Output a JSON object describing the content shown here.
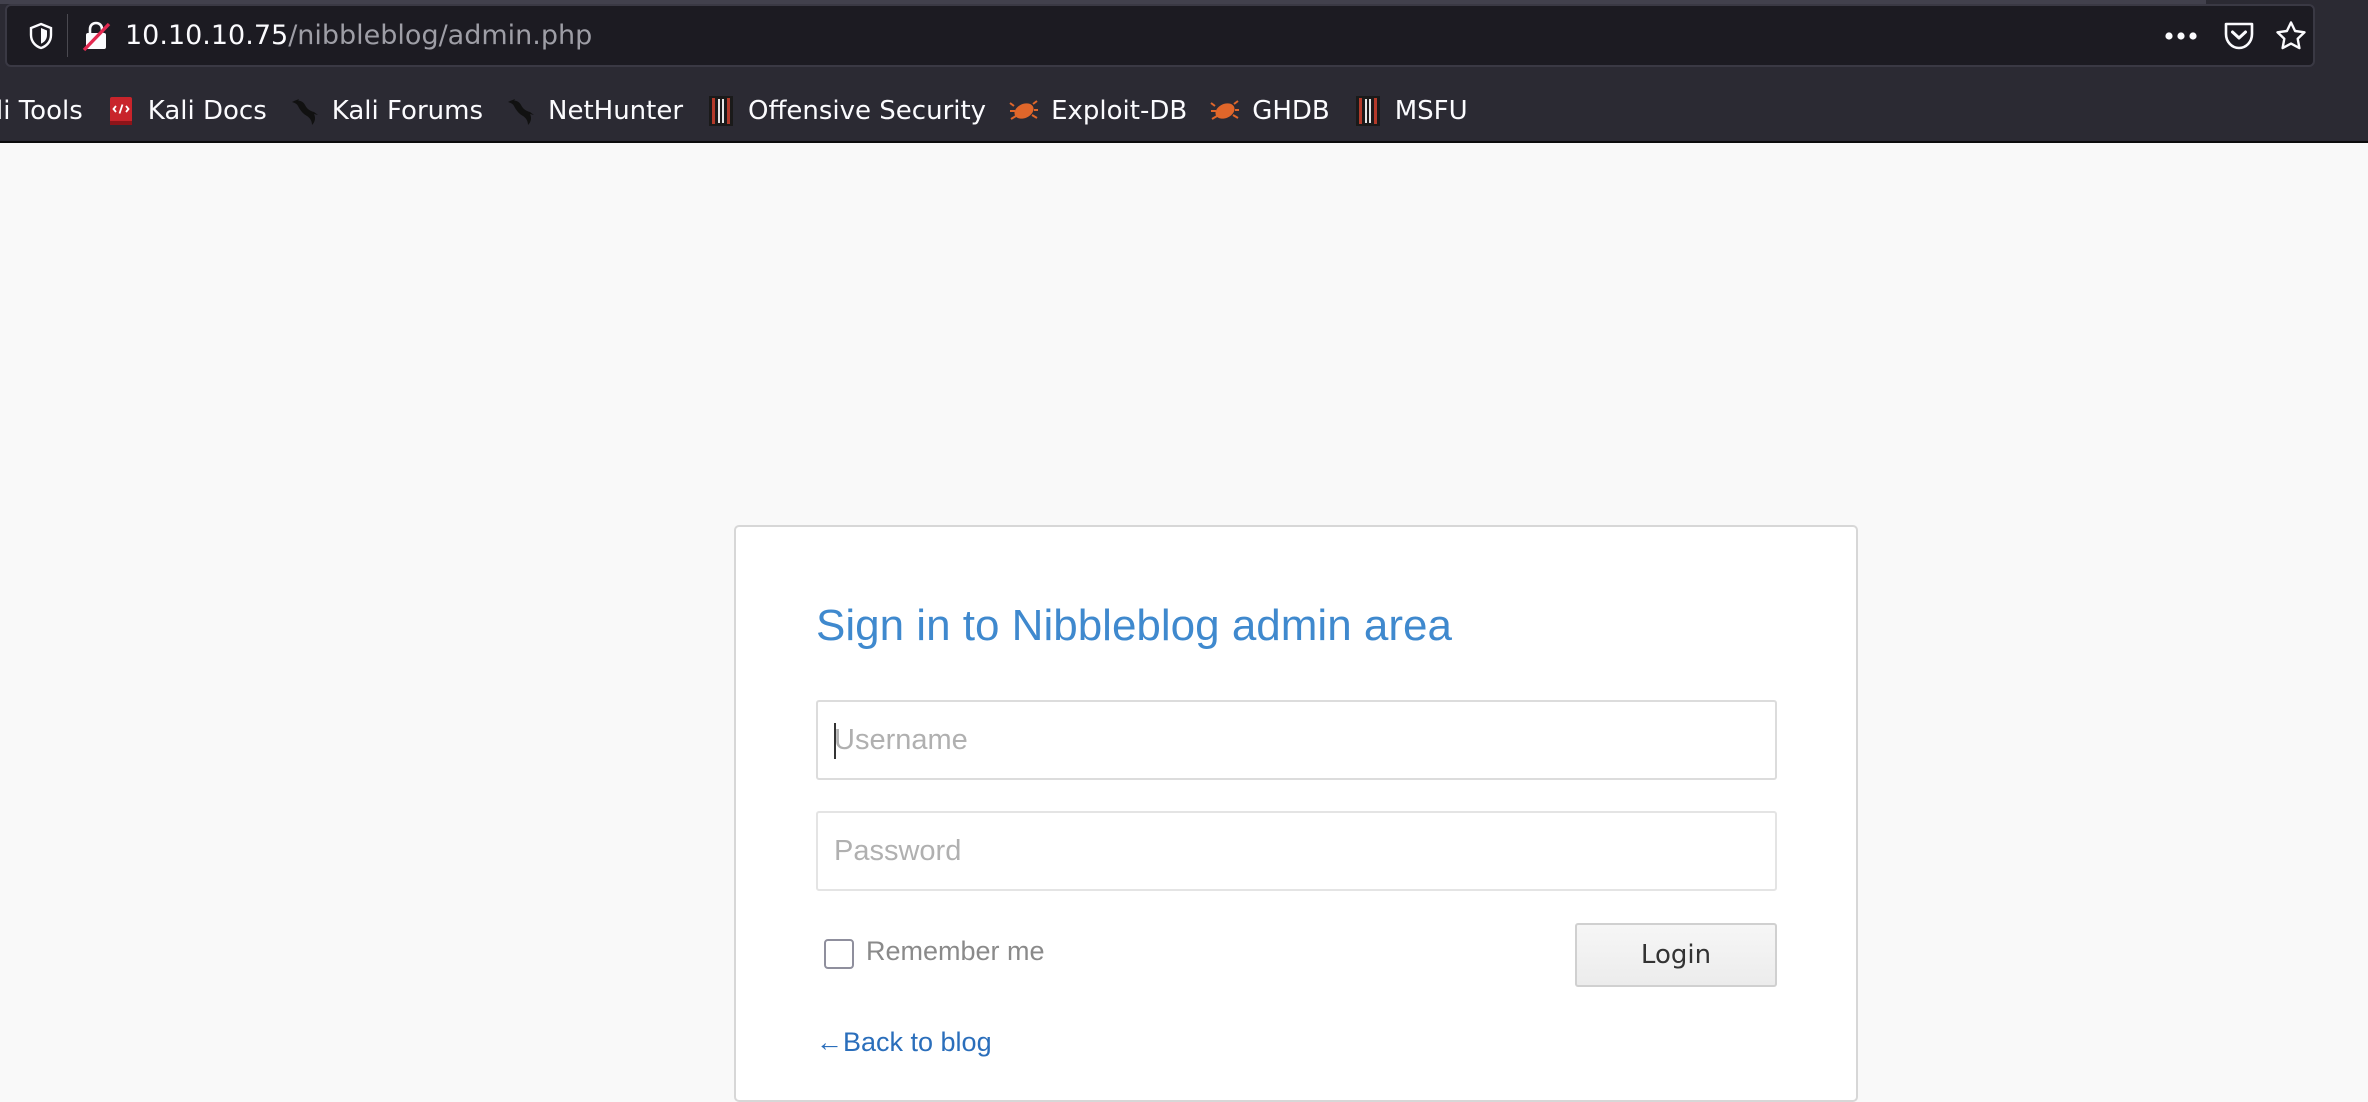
{
  "browser": {
    "url_host": "10.10.10.75",
    "url_path": "/nibbleblog/admin.php",
    "icons": {
      "tracking_protection": "shield-icon",
      "connection": "insecure-lock-icon",
      "page_actions": "more-horizontal-icon",
      "pocket": "pocket-icon",
      "bookmark_star": "star-icon"
    }
  },
  "bookmarks": [
    {
      "label": "li Tools",
      "icon": "none"
    },
    {
      "label": "Kali Docs",
      "icon": "kali-docs-icon"
    },
    {
      "label": "Kali Forums",
      "icon": "kali-dragon-icon"
    },
    {
      "label": "NetHunter",
      "icon": "kali-dragon-icon"
    },
    {
      "label": "Offensive Security",
      "icon": "offsec-icon"
    },
    {
      "label": "Exploit-DB",
      "icon": "exploitdb-bug-icon"
    },
    {
      "label": "GHDB",
      "icon": "exploitdb-bug-icon"
    },
    {
      "label": "MSFU",
      "icon": "offsec-icon"
    }
  ],
  "login": {
    "heading": "Sign in to Nibbleblog admin area",
    "username_placeholder": "Username",
    "password_placeholder": "Password",
    "remember_label": "Remember me",
    "login_label": "Login",
    "back_link": "←Back to blog"
  },
  "colors": {
    "heading_blue": "#3f89ce",
    "link_blue": "#2a6ebb",
    "chrome_dark": "#2b2a33"
  }
}
